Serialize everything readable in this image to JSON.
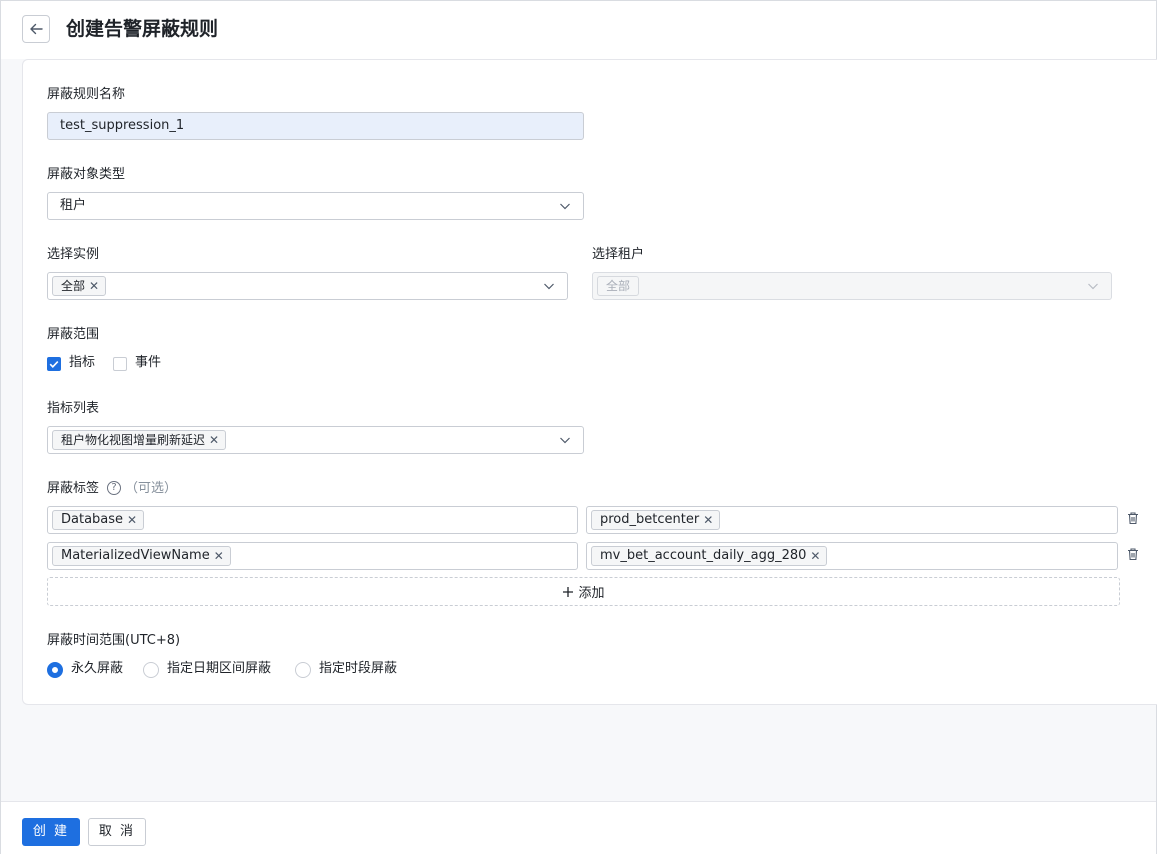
{
  "header": {
    "title": "创建告警屏蔽规则"
  },
  "form": {
    "rule_name": {
      "label": "屏蔽规则名称",
      "value": "test_suppression_1"
    },
    "target_type": {
      "label": "屏蔽对象类型",
      "value": "租户"
    },
    "instance": {
      "label": "选择实例",
      "tags": [
        "全部"
      ]
    },
    "tenant": {
      "label": "选择租户",
      "tags": [
        "全部"
      ]
    },
    "scope": {
      "label": "屏蔽范围",
      "options": [
        {
          "label": "指标",
          "checked": true
        },
        {
          "label": "事件",
          "checked": false
        }
      ]
    },
    "metrics": {
      "label": "指标列表",
      "tags": [
        "租户物化视图增量刷新延迟"
      ]
    },
    "labels": {
      "label": "屏蔽标签",
      "optional": "（可选）",
      "rows": [
        {
          "key": "Database",
          "value": "prod_betcenter"
        },
        {
          "key": "MaterializedViewName",
          "value": "mv_bet_account_daily_agg_280"
        }
      ],
      "add_label": "添加"
    },
    "time_range": {
      "label": "屏蔽时间范围(UTC+8)",
      "options": [
        {
          "label": "永久屏蔽",
          "selected": true
        },
        {
          "label": "指定日期区间屏蔽",
          "selected": false
        },
        {
          "label": "指定时段屏蔽",
          "selected": false
        }
      ]
    }
  },
  "footer": {
    "create_label": "创 建",
    "cancel_label": "取 消"
  },
  "colors": {
    "accent": "#1e6fe0",
    "input_filled_bg": "#e8effb"
  }
}
